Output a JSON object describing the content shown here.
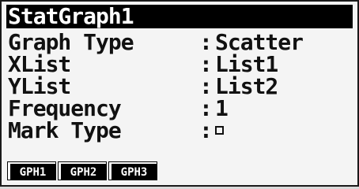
{
  "title": "StatGraph1",
  "settings": [
    {
      "label": "Graph Type",
      "separator": ":",
      "value": "Scatter"
    },
    {
      "label": "XList",
      "separator": ":",
      "value": "List1"
    },
    {
      "label": "YList",
      "separator": ":",
      "value": "List2"
    },
    {
      "label": "Frequency",
      "separator": ":",
      "value": "1"
    },
    {
      "label": "Mark Type",
      "separator": ":",
      "value_icon": "square-mark-icon"
    }
  ],
  "function_keys": [
    {
      "label": "GPH1"
    },
    {
      "label": "GPH2"
    },
    {
      "label": "GPH3"
    }
  ]
}
